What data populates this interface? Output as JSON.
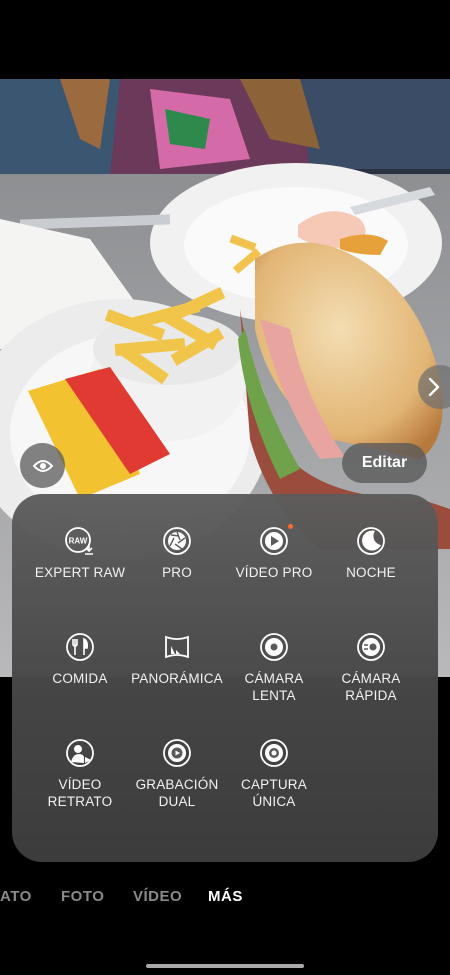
{
  "viewfinder": {
    "description_free": ""
  },
  "controls": {
    "edit_label": "Editar"
  },
  "more_modes": [
    {
      "label": "EXPERT RAW",
      "icon": "expert-raw-icon",
      "name": "mode-expert-raw"
    },
    {
      "label": "PRO",
      "icon": "aperture-icon",
      "name": "mode-pro"
    },
    {
      "label": "VÍDEO PRO",
      "icon": "video-pro-icon",
      "name": "mode-video-pro",
      "new_badge": true
    },
    {
      "label": "NOCHE",
      "icon": "moon-icon",
      "name": "mode-noche"
    },
    {
      "label": "COMIDA",
      "icon": "food-icon",
      "name": "mode-comida"
    },
    {
      "label": "PANORÁMICA",
      "icon": "panorama-icon",
      "name": "mode-panoramica"
    },
    {
      "label": "CÁMARA\nLENTA",
      "icon": "slow-motion-icon",
      "name": "mode-camara-lenta"
    },
    {
      "label": "CÁMARA\nRÁPIDA",
      "icon": "hyperlapse-icon",
      "name": "mode-camara-rapida"
    },
    {
      "label": "VÍDEO\nRETRATO",
      "icon": "portrait-video-icon",
      "name": "mode-video-retrato"
    },
    {
      "label": "GRABACIÓN\nDUAL",
      "icon": "dual-recording-icon",
      "name": "mode-grabacion-dual"
    },
    {
      "label": "CAPTURA\nÚNICA",
      "icon": "single-take-icon",
      "name": "mode-captura-unica"
    }
  ],
  "mode_bar": {
    "items": [
      "ATO",
      "FOTO",
      "VÍDEO",
      "MÁS"
    ],
    "active": "MÁS"
  },
  "colors": {
    "new_badge": "#ff6a2a",
    "panel": "#5c5c5c"
  }
}
